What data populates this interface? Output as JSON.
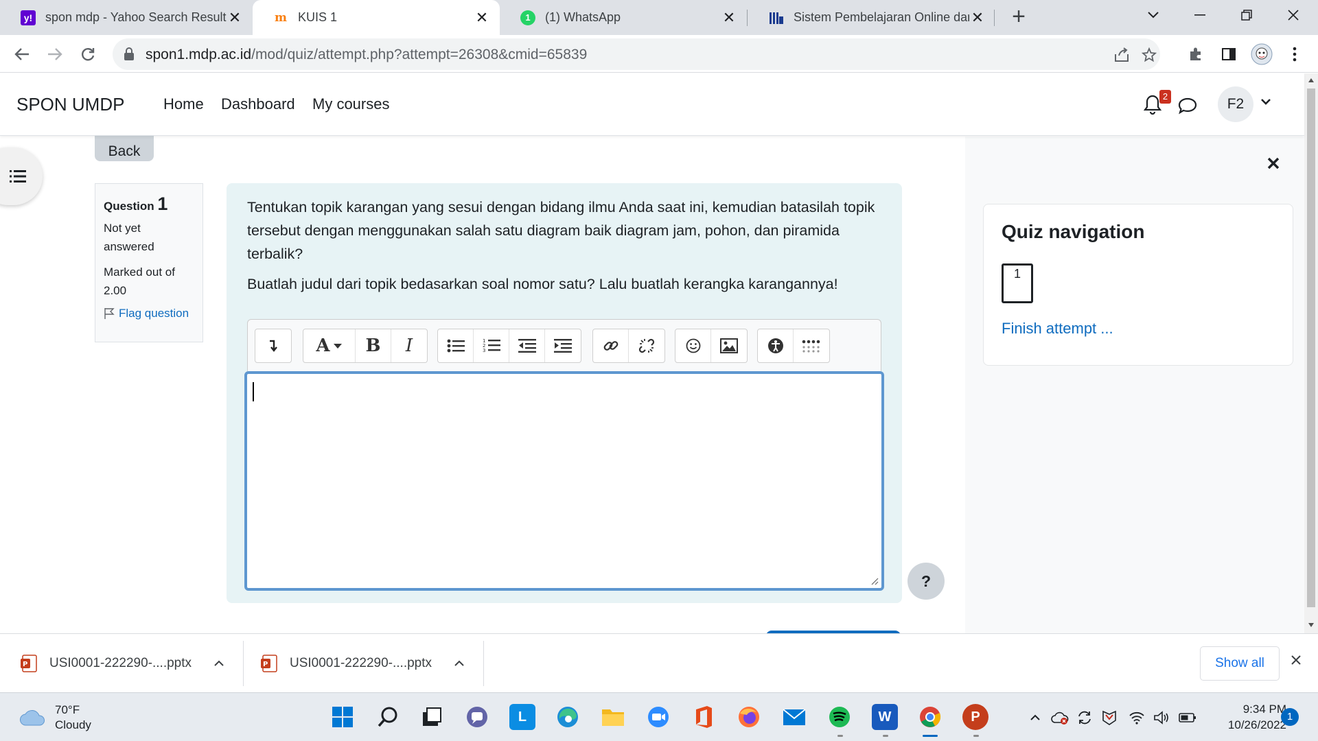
{
  "browser": {
    "tabs": [
      {
        "title": "spon mdp - Yahoo Search Results",
        "favicon": "yahoo-icon",
        "active": false
      },
      {
        "title": "KUIS 1",
        "favicon": "moodle-icon",
        "active": true
      },
      {
        "title": "(1) WhatsApp",
        "favicon": "whatsapp-icon",
        "badge": "1",
        "active": false
      },
      {
        "title": "Sistem Pembelajaran Online dan",
        "favicon": "library-icon",
        "active": false
      }
    ],
    "url_host": "spon1.mdp.ac.id",
    "url_path": "/mod/quiz/attempt.php?attempt=26308&cmid=65839"
  },
  "site": {
    "brand": "SPON UMDP",
    "nav": [
      "Home",
      "Dashboard",
      "My courses"
    ],
    "notification_count": "2",
    "user_initials": "F2"
  },
  "quiz": {
    "back_label": "Back",
    "question_label": "Question",
    "question_number": "1",
    "state": "Not yet answered",
    "grade": "Marked out of 2.00",
    "flag_label": "Flag question",
    "text_1": "Tentukan topik karangan yang sesui dengan bidang ilmu Anda saat ini, kemudian batasilah topik tersebut dengan menggunakan salah satu diagram baik diagram jam, pohon, dan piramida terbalik?",
    "text_2": "Buatlah judul dari topik bedasarkan soal nomor satu? Lalu buatlah kerangka karangannya!",
    "answer_value": "",
    "help_label": "?"
  },
  "drawer": {
    "title": "Quiz navigation",
    "question_buttons": [
      "1"
    ],
    "finish_label": "Finish attempt ..."
  },
  "downloads": {
    "items": [
      "USI0001-222290-....pptx",
      "USI0001-222290-....pptx"
    ],
    "show_all_label": "Show all"
  },
  "taskbar": {
    "temperature": "70°F",
    "condition": "Cloudy",
    "time": "9:34 PM",
    "date": "10/26/2022",
    "notification_count": "1"
  },
  "colors": {
    "accent": "#0f6cbf",
    "question_bg": "#e7f3f5",
    "editor_focus": "#5e97d0",
    "badge": "#ca3120"
  }
}
